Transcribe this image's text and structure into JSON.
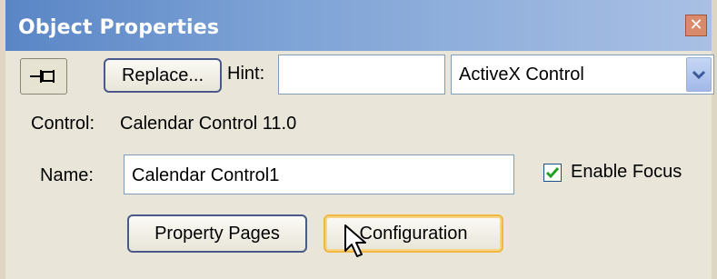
{
  "window": {
    "title": "Object Properties",
    "close_icon": "close-icon"
  },
  "toolbar": {
    "pin_icon": "pin-icon",
    "replace_label": "Replace...",
    "hint_label": "Hint:",
    "hint_value": "",
    "type_select_value": "ActiveX Control"
  },
  "control": {
    "label": "Control:",
    "value": "Calendar Control 11.0"
  },
  "name": {
    "label": "Name:",
    "value": "Calendar Control1"
  },
  "enable_focus": {
    "label": "Enable Focus",
    "checked": true
  },
  "buttons": {
    "property_pages_label": "Property Pages",
    "configuration_label": "Configuration"
  },
  "colors": {
    "title_gradient_start": "#5a86c6",
    "panel_bg": "#e9e6d9",
    "focus_highlight": "#f0b840"
  }
}
